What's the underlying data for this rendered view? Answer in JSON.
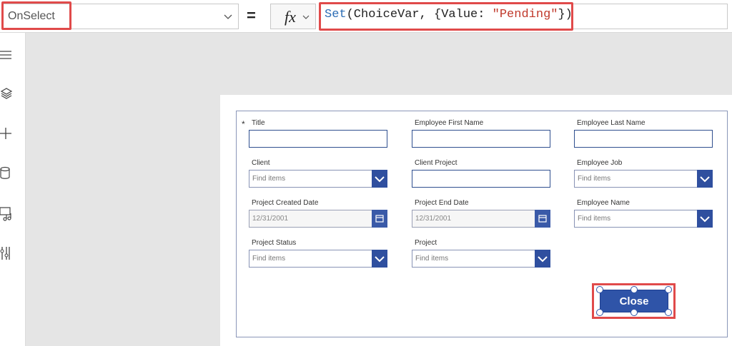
{
  "formula_bar": {
    "property": "OnSelect",
    "equals": "=",
    "fx": "fx",
    "formula": {
      "fn": "Set",
      "part1": "(ChoiceVar, {Value: ",
      "str": "\"Pending\"",
      "part2": "})"
    }
  },
  "rail": {
    "icons": [
      "menu-icon",
      "layers-icon",
      "plus-icon",
      "database-icon",
      "media-icon",
      "tools-icon"
    ]
  },
  "form": {
    "fields": {
      "title": {
        "label": "Title",
        "required_mark": "*"
      },
      "emp_first": {
        "label": "Employee First Name"
      },
      "emp_last": {
        "label": "Employee Last Name"
      },
      "client": {
        "label": "Client",
        "placeholder": "Find items"
      },
      "client_project": {
        "label": "Client Project"
      },
      "employee_job": {
        "label": "Employee Job",
        "placeholder": "Find items"
      },
      "project_created": {
        "label": "Project Created Date",
        "value": "12/31/2001"
      },
      "project_end": {
        "label": "Project End Date",
        "value": "12/31/2001"
      },
      "employee_name": {
        "label": "Employee Name",
        "placeholder": "Find items"
      },
      "project_status": {
        "label": "Project Status",
        "placeholder": "Find items"
      },
      "project": {
        "label": "Project",
        "placeholder": "Find items"
      }
    },
    "close_button": "Close"
  },
  "colors": {
    "accent": "#2f54a8",
    "highlight": "#e04a4a"
  }
}
